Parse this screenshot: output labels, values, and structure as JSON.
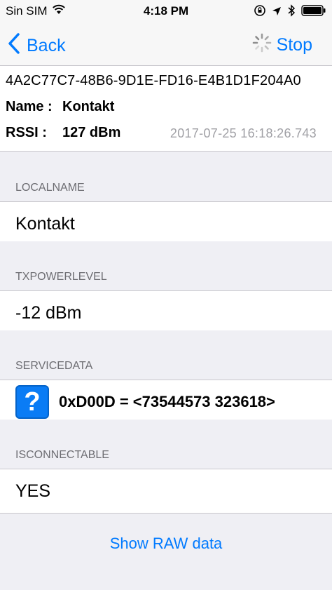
{
  "status_bar": {
    "carrier": "Sin SIM",
    "time": "4:18 PM"
  },
  "nav": {
    "back_label": "Back",
    "stop_label": "Stop"
  },
  "device": {
    "uuid": "4A2C77C7-48B6-9D1E-FD16-E4B1D1F204A0",
    "name_label": "Name :",
    "name_value": "Kontakt",
    "rssi_label": "RSSI :",
    "rssi_value": "127 dBm",
    "timestamp": "2017-07-25 16:18:26.743"
  },
  "sections": {
    "localname": {
      "header": "LOCALNAME",
      "value": "Kontakt"
    },
    "txpowerlevel": {
      "header": "TXPOWERLEVEL",
      "value": "-12 dBm"
    },
    "servicedata": {
      "header": "SERVICEDATA",
      "icon_glyph": "?",
      "value": "0xD00D = <73544573 323618>"
    },
    "isconnectable": {
      "header": "ISCONNECTABLE",
      "value": "YES"
    }
  },
  "footer": {
    "raw_label": "Show RAW data"
  },
  "colors": {
    "accent": "#007aff",
    "icon_bg": "#0a7cf5",
    "secondary_text": "#6d6d72"
  }
}
